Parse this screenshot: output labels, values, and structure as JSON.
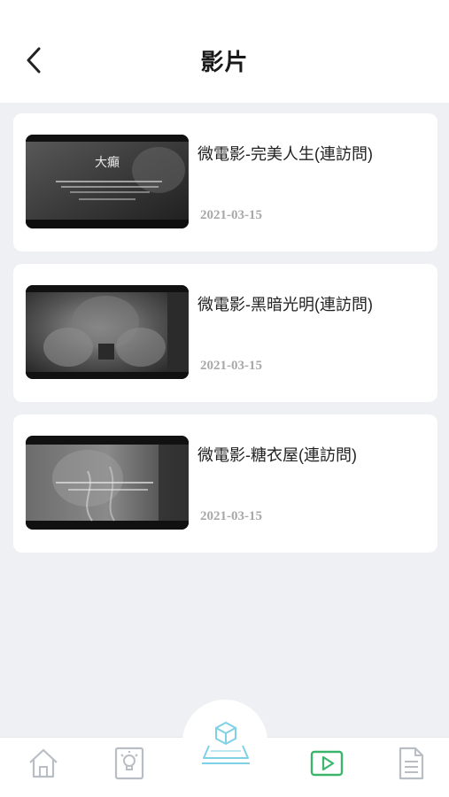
{
  "header": {
    "title": "影片"
  },
  "videos": [
    {
      "title": "微電影-完美人生(連訪問)",
      "date": "2021-03-15",
      "thumb_text": "大癲"
    },
    {
      "title": "微電影-黑暗光明(連訪問)",
      "date": "2021-03-15",
      "thumb_text": ""
    },
    {
      "title": "微電影-糖衣屋(連訪問)",
      "date": "2021-03-15",
      "thumb_text": ""
    }
  ],
  "nav": {
    "items": [
      "home-icon",
      "lightbulb-icon",
      "vr-box-icon",
      "play-video-icon",
      "document-icon"
    ],
    "active": "play-video-icon",
    "active_color": "#3bb56c",
    "inactive_color": "#b9bec4",
    "center_color": "#7fd1e6"
  }
}
